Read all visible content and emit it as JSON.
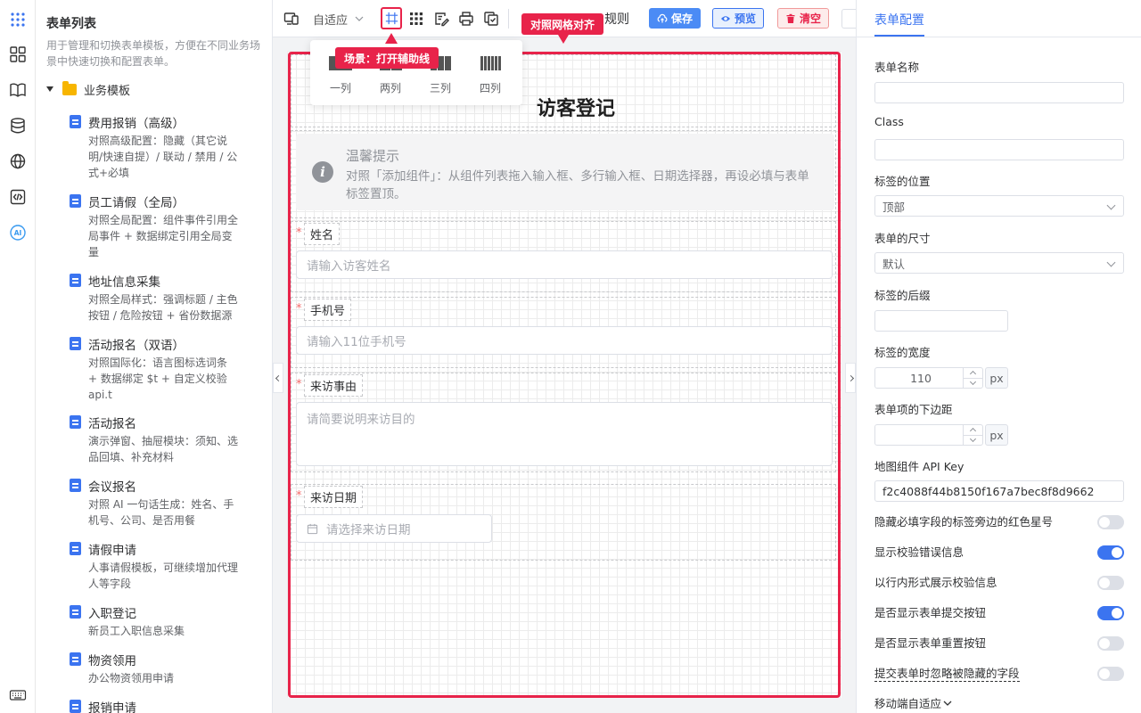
{
  "left_panel": {
    "title": "表单列表",
    "description": "用于管理和切换表单模板，方便在不同业务场景中快速切换和配置表单。",
    "folder": "业务模板",
    "templates": [
      {
        "name": "费用报销（高级）",
        "desc": "对照高级配置：隐藏（其它说明/快速自提）/ 联动 / 禁用 / 公式+必填"
      },
      {
        "name": "员工请假（全局）",
        "desc": "对照全局配置：组件事件引用全局事件 + 数据绑定引用全局变量"
      },
      {
        "name": "地址信息采集",
        "desc": "对照全局样式：强调标题 / 主色按钮 / 危险按钮 + 省份数据源"
      },
      {
        "name": "活动报名（双语）",
        "desc": "对照国际化：语言图标选词条 + 数据绑定 $t + 自定义校验 api.t"
      },
      {
        "name": "活动报名",
        "desc": "演示弹窗、抽屉模块：须知、选品回填、补充材料"
      },
      {
        "name": "会议报名",
        "desc": "对照 AI 一句话生成：姓名、手机号、公司、是否用餐"
      },
      {
        "name": "请假申请",
        "desc": "人事请假模板，可继续增加代理人等字段"
      },
      {
        "name": "入职登记",
        "desc": "新员工入职信息采集"
      },
      {
        "name": "物资领用",
        "desc": "办公物资领用申请"
      },
      {
        "name": "报销申请",
        "desc": ""
      }
    ]
  },
  "toolbar": {
    "device_select": "自适应",
    "rules_label": "规则",
    "save_label": "保存",
    "preview_label": "预览",
    "clear_label": "清空"
  },
  "column_popup": {
    "options": [
      "一列",
      "两列",
      "三列",
      "四列"
    ]
  },
  "callouts": {
    "scene": "场景：打开辅助线",
    "grid": "对照网格对齐"
  },
  "form": {
    "title": "访客登记",
    "notice_title": "温馨提示",
    "notice_text": "对照「添加组件」：从组件列表拖入输入框、多行输入框、日期选择器，再设必填与表单标签置顶。",
    "fields": [
      {
        "label": "姓名",
        "placeholder": "请输入访客姓名"
      },
      {
        "label": "手机号",
        "placeholder": "请输入11位手机号"
      },
      {
        "label": "来访事由",
        "placeholder": "请简要说明来访目的"
      },
      {
        "label": "来访日期",
        "placeholder": "请选择来访日期"
      }
    ]
  },
  "right_panel": {
    "tab": "表单配置",
    "form_name_label": "表单名称",
    "form_name_value": "",
    "class_label": "Class",
    "class_value": "",
    "label_position_label": "标签的位置",
    "label_position_value": "顶部",
    "form_size_label": "表单的尺寸",
    "form_size_value": "默认",
    "label_suffix_label": "标签的后缀",
    "label_width_label": "标签的宽度",
    "label_width_value": "110",
    "label_width_unit": "px",
    "item_margin_label": "表单项的下边距",
    "item_margin_unit": "px",
    "map_key_label": "地图组件 API Key",
    "map_key_value": "f2c4088f44b8150f167a7bec8f8d9662",
    "switches": [
      {
        "label": "隐藏必填字段的标签旁边的红色星号",
        "on": false
      },
      {
        "label": "显示校验错误信息",
        "on": true
      },
      {
        "label": "以行内形式展示校验信息",
        "on": false
      },
      {
        "label": "是否显示表单提交按钮",
        "on": true
      },
      {
        "label": "是否显示表单重置按钮",
        "on": false
      },
      {
        "label": "提交表单时忽略被隐藏的字段",
        "on": false
      }
    ],
    "mobile_label": "移动端自适应"
  },
  "colors": {
    "accent": "#3b74f0",
    "danger": "#e8234a",
    "save": "#4b8bf5"
  }
}
